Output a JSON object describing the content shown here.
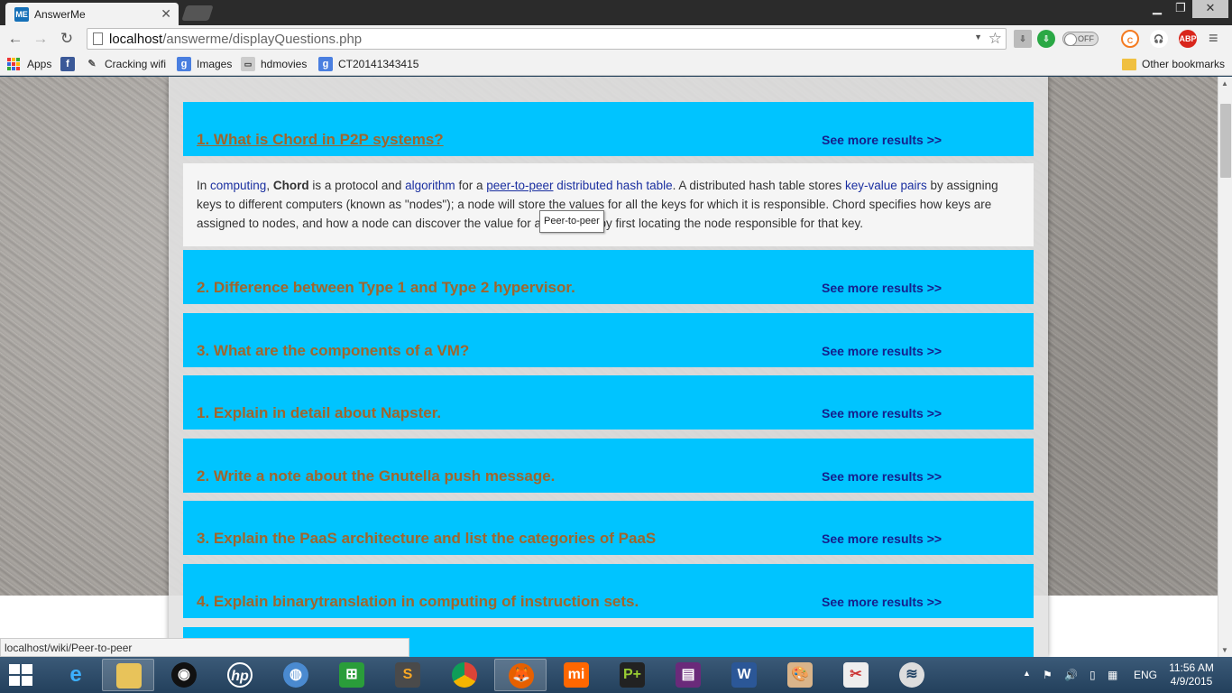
{
  "browser": {
    "tab_title": "AnswerMe",
    "tab_icon_text": "ME",
    "url_host": "localhost",
    "url_path": "/answerme/displayQuestions.php",
    "toggle_label": "OFF",
    "abp_label": "ABP"
  },
  "bookmarks": {
    "apps": "Apps",
    "items": [
      "Cracking wifi",
      "Images",
      "hdmovies",
      "CT20141343415"
    ],
    "other": "Other bookmarks"
  },
  "questions": [
    {
      "title": "1. What is Chord in P2P systems?",
      "more": "See more results >>"
    },
    {
      "title": "2. Difference between Type 1 and Type 2 hypervisor.",
      "more": "See more results >>"
    },
    {
      "title": "3. What are the components of a VM?",
      "more": "See more results >>"
    },
    {
      "title": "1. Explain in detail about Napster.",
      "more": "See more results >>"
    },
    {
      "title": "2. Write a note about the Gnutella push message.",
      "more": "See more results >>"
    },
    {
      "title": "3. Explain the PaaS architecture and list the categories of PaaS",
      "more": "See more results >>"
    },
    {
      "title": "4. Explain binarytranslation in computing of instruction sets.",
      "more": "See more results >>"
    }
  ],
  "answer": {
    "t1": "In ",
    "link_computing": "computing",
    "t2": ", ",
    "bold_chord": "Chord",
    "t3": " is a protocol and ",
    "link_algorithm": "algorithm",
    "t4": " for a ",
    "link_p2p": "peer-to-peer",
    "t5": " ",
    "link_dht": "distributed hash table",
    "t6": ". A distributed hash table stores ",
    "link_kv": "key-value pairs",
    "t7": " by assigning keys to different computers (known as \"nodes\"); a node will store the values for all the keys for which it is responsible. Chord specifies how keys are assigned to nodes, and how a node can discover the value for a given key by first locating the node responsible for that key."
  },
  "tooltip": "Peer-to-peer",
  "status_url": "localhost/wiki/Peer-to-peer",
  "taskbar": {
    "lang": "ENG",
    "time": "11:56 AM",
    "date": "4/9/2015"
  }
}
